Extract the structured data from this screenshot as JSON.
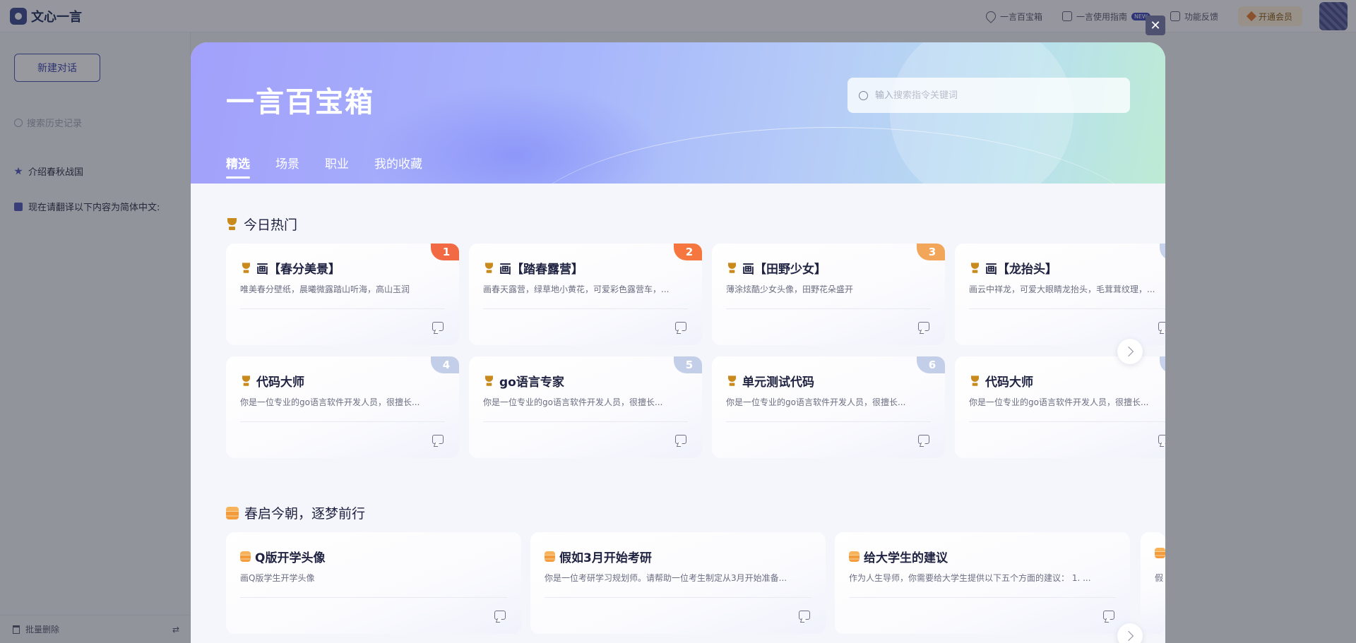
{
  "app": {
    "name": "文心一言"
  },
  "header": {
    "links": [
      {
        "label": "一言百宝箱",
        "icon": "location-pin-icon"
      },
      {
        "label": "一言使用指南",
        "icon": "book-icon",
        "badge": "NEW"
      },
      {
        "label": "功能反馈",
        "icon": "feedback-mail-icon"
      }
    ],
    "vip_label": "开通会员"
  },
  "sidebar": {
    "new_chat": "新建对话",
    "search_placeholder": "搜索历史记录",
    "history": [
      {
        "label": "介绍春秋战国",
        "icon": "pin-star-icon"
      },
      {
        "label": "现在请翻译以下内容为简体中文:",
        "icon": "chat-icon"
      }
    ],
    "bulk_delete": "批量删除"
  },
  "modal": {
    "title": "一言百宝箱",
    "search_placeholder": "输入搜索指令关键词",
    "tabs": [
      "精选",
      "场景",
      "职业",
      "我的收藏"
    ],
    "active_tab": "精选",
    "sections": [
      {
        "title": "今日热门",
        "icon": "trophy-icon",
        "cards": [
          {
            "title": "画【春分美景】",
            "desc": "唯美春分壁纸，晨曦微露踏山听海，高山玉润",
            "rank": "1",
            "rank_color": "#f26a43"
          },
          {
            "title": "画【踏春露营】",
            "desc": "画春天露营，绿草地小黄花，可爱彩色露营车，...",
            "rank": "2",
            "rank_color": "#f5773f"
          },
          {
            "title": "画【田野少女】",
            "desc": "薄涂炫酷少女头像，田野花朵盛开",
            "rank": "3",
            "rank_color": "#f2a65a"
          },
          {
            "title": "画【龙抬头】",
            "desc": "画云中祥龙，可爱大眼睛龙抬头，毛茸茸纹理，...",
            "rank": "",
            "rank_color": "#c7d3ec"
          },
          {
            "title": "代码大师",
            "desc": "你是一位专业的go语言软件开发人员，很擅长...",
            "rank": "4",
            "rank_color": "#c3cfe9"
          },
          {
            "title": "go语言专家",
            "desc": "你是一位专业的go语言软件开发人员，很擅长...",
            "rank": "5",
            "rank_color": "#c3cfe9"
          },
          {
            "title": "单元测试代码",
            "desc": "你是一位专业的go语言软件开发人员，很擅长...",
            "rank": "6",
            "rank_color": "#c3cfe9"
          },
          {
            "title": "代码大师",
            "desc": "你是一位专业的go语言软件开发人员，很擅长...",
            "rank": "",
            "rank_color": "#c7d3ec"
          }
        ]
      },
      {
        "title": "春启今朝，逐梦前行",
        "icon": "stack-icon",
        "cards": [
          {
            "title": "Q版开学头像",
            "desc": "画Q版学生开学头像"
          },
          {
            "title": "假如3月开始考研",
            "desc": "你是一位考研学习规划师。请帮助一位考生制定从3月开始准备..."
          },
          {
            "title": "给大学生的建议",
            "desc": "作为人生导师，你需要给大学生提供以下五个方面的建议： 1. ..."
          },
          {
            "title": "",
            "desc": "假"
          }
        ]
      }
    ]
  }
}
